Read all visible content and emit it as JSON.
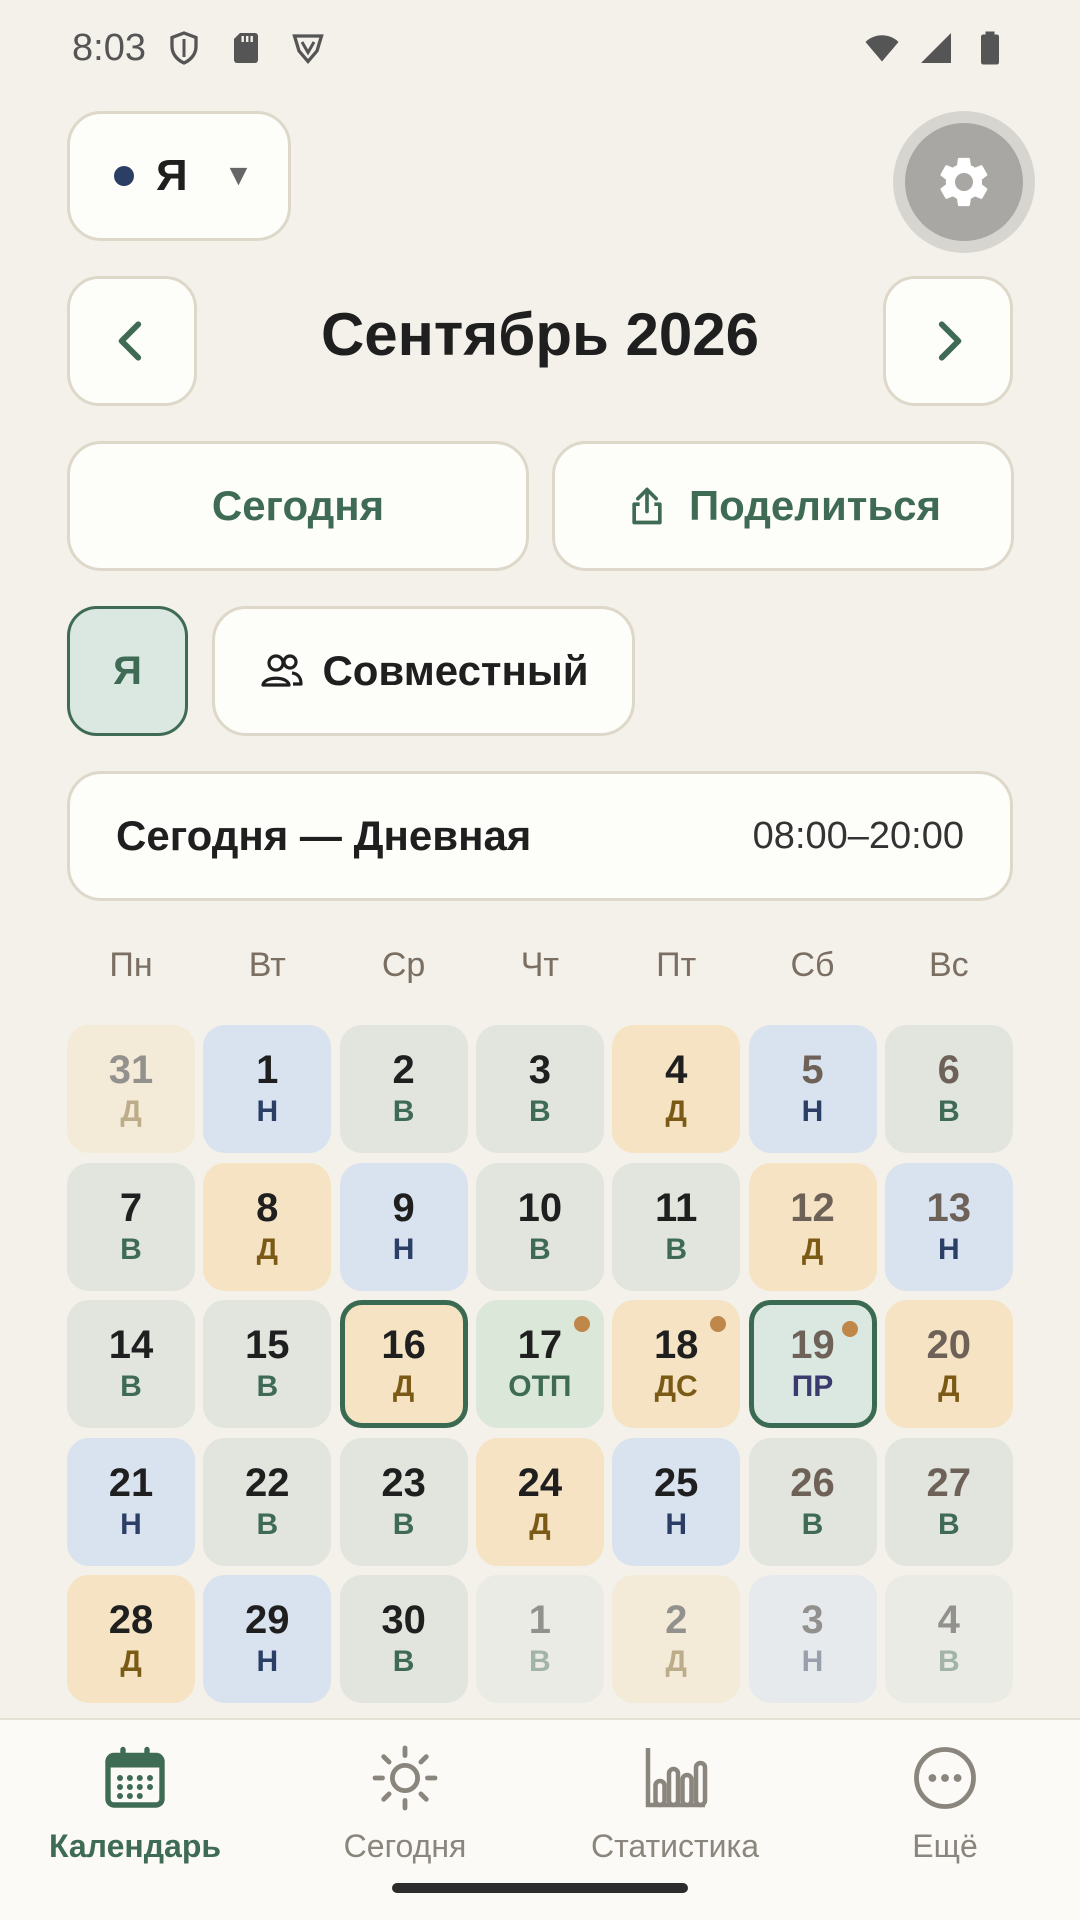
{
  "status_bar": {
    "time": "8:03",
    "icons_left": [
      "shield-icon",
      "sd-card-icon",
      "vpn-icon"
    ],
    "icons_right": [
      "wifi-icon",
      "signal-icon",
      "battery-icon"
    ]
  },
  "header": {
    "profile_name": "Я",
    "profile_color": "#2b3f66",
    "settings_icon": "gear-icon"
  },
  "month_nav": {
    "title": "Сентябрь 2026",
    "prev_icon": "chevron-left-icon",
    "next_icon": "chevron-right-icon"
  },
  "actions": {
    "today_label": "Сегодня",
    "share_label": "Поделиться"
  },
  "modes": {
    "me_label": "Я",
    "joint_label": "Совместный"
  },
  "today_banner": {
    "label": "Сегодня — Дневная",
    "time": "08:00–20:00"
  },
  "weekdays": [
    "Пн",
    "Вт",
    "Ср",
    "Чт",
    "Пт",
    "Сб",
    "Вс"
  ],
  "weeks": [
    [
      {
        "day": "31",
        "code": "Д",
        "type": "D",
        "muted": true
      },
      {
        "day": "1",
        "code": "Н",
        "type": "N"
      },
      {
        "day": "2",
        "code": "В",
        "type": "V"
      },
      {
        "day": "3",
        "code": "В",
        "type": "V"
      },
      {
        "day": "4",
        "code": "Д",
        "type": "D"
      },
      {
        "day": "5",
        "code": "Н",
        "type": "N",
        "weekend": true
      },
      {
        "day": "6",
        "code": "В",
        "type": "V",
        "weekend": true
      }
    ],
    [
      {
        "day": "7",
        "code": "В",
        "type": "V"
      },
      {
        "day": "8",
        "code": "Д",
        "type": "D"
      },
      {
        "day": "9",
        "code": "Н",
        "type": "N"
      },
      {
        "day": "10",
        "code": "В",
        "type": "V"
      },
      {
        "day": "11",
        "code": "В",
        "type": "V"
      },
      {
        "day": "12",
        "code": "Д",
        "type": "D",
        "weekend": true
      },
      {
        "day": "13",
        "code": "Н",
        "type": "N",
        "weekend": true
      }
    ],
    [
      {
        "day": "14",
        "code": "В",
        "type": "V"
      },
      {
        "day": "15",
        "code": "В",
        "type": "V"
      },
      {
        "day": "16",
        "code": "Д",
        "type": "D",
        "selected": true
      },
      {
        "day": "17",
        "code": "ОТП",
        "type": "OTP",
        "dot": true
      },
      {
        "day": "18",
        "code": "ДС",
        "type": "D",
        "dot": true
      },
      {
        "day": "19",
        "code": "ПР",
        "type": "PR",
        "dot": true,
        "selected": true,
        "weekend": true
      },
      {
        "day": "20",
        "code": "Д",
        "type": "D",
        "weekend": true
      }
    ],
    [
      {
        "day": "21",
        "code": "Н",
        "type": "N"
      },
      {
        "day": "22",
        "code": "В",
        "type": "V"
      },
      {
        "day": "23",
        "code": "В",
        "type": "V"
      },
      {
        "day": "24",
        "code": "Д",
        "type": "D"
      },
      {
        "day": "25",
        "code": "Н",
        "type": "N"
      },
      {
        "day": "26",
        "code": "В",
        "type": "V",
        "weekend": true
      },
      {
        "day": "27",
        "code": "В",
        "type": "V",
        "weekend": true
      }
    ],
    [
      {
        "day": "28",
        "code": "Д",
        "type": "D"
      },
      {
        "day": "29",
        "code": "Н",
        "type": "N"
      },
      {
        "day": "30",
        "code": "В",
        "type": "V"
      },
      {
        "day": "1",
        "code": "В",
        "type": "V",
        "muted": true
      },
      {
        "day": "2",
        "code": "Д",
        "type": "D",
        "muted": true
      },
      {
        "day": "3",
        "code": "Н",
        "type": "N",
        "muted": true
      },
      {
        "day": "4",
        "code": "В",
        "type": "V",
        "muted": true
      }
    ]
  ],
  "colors": {
    "D_bg": "#f5e3c4",
    "D_code": "#7a5a14",
    "N_bg": "#d9e2ef",
    "N_code": "#2b3f66",
    "V_bg": "#e1e5de",
    "V_code": "#3f6b55",
    "OTP_bg": "#dbe8d9",
    "OTP_code": "#3f6b55",
    "PR_bg": "#dbe8e1",
    "PR_code": "#3b3a6e",
    "accent": "#3f6b55",
    "dot": "#c0874a"
  },
  "bottom_nav": [
    {
      "label": "Календарь",
      "icon": "calendar-icon",
      "active": true
    },
    {
      "label": "Сегодня",
      "icon": "sun-icon"
    },
    {
      "label": "Статистика",
      "icon": "bar-chart-icon"
    },
    {
      "label": "Ещё",
      "icon": "more-icon"
    }
  ]
}
